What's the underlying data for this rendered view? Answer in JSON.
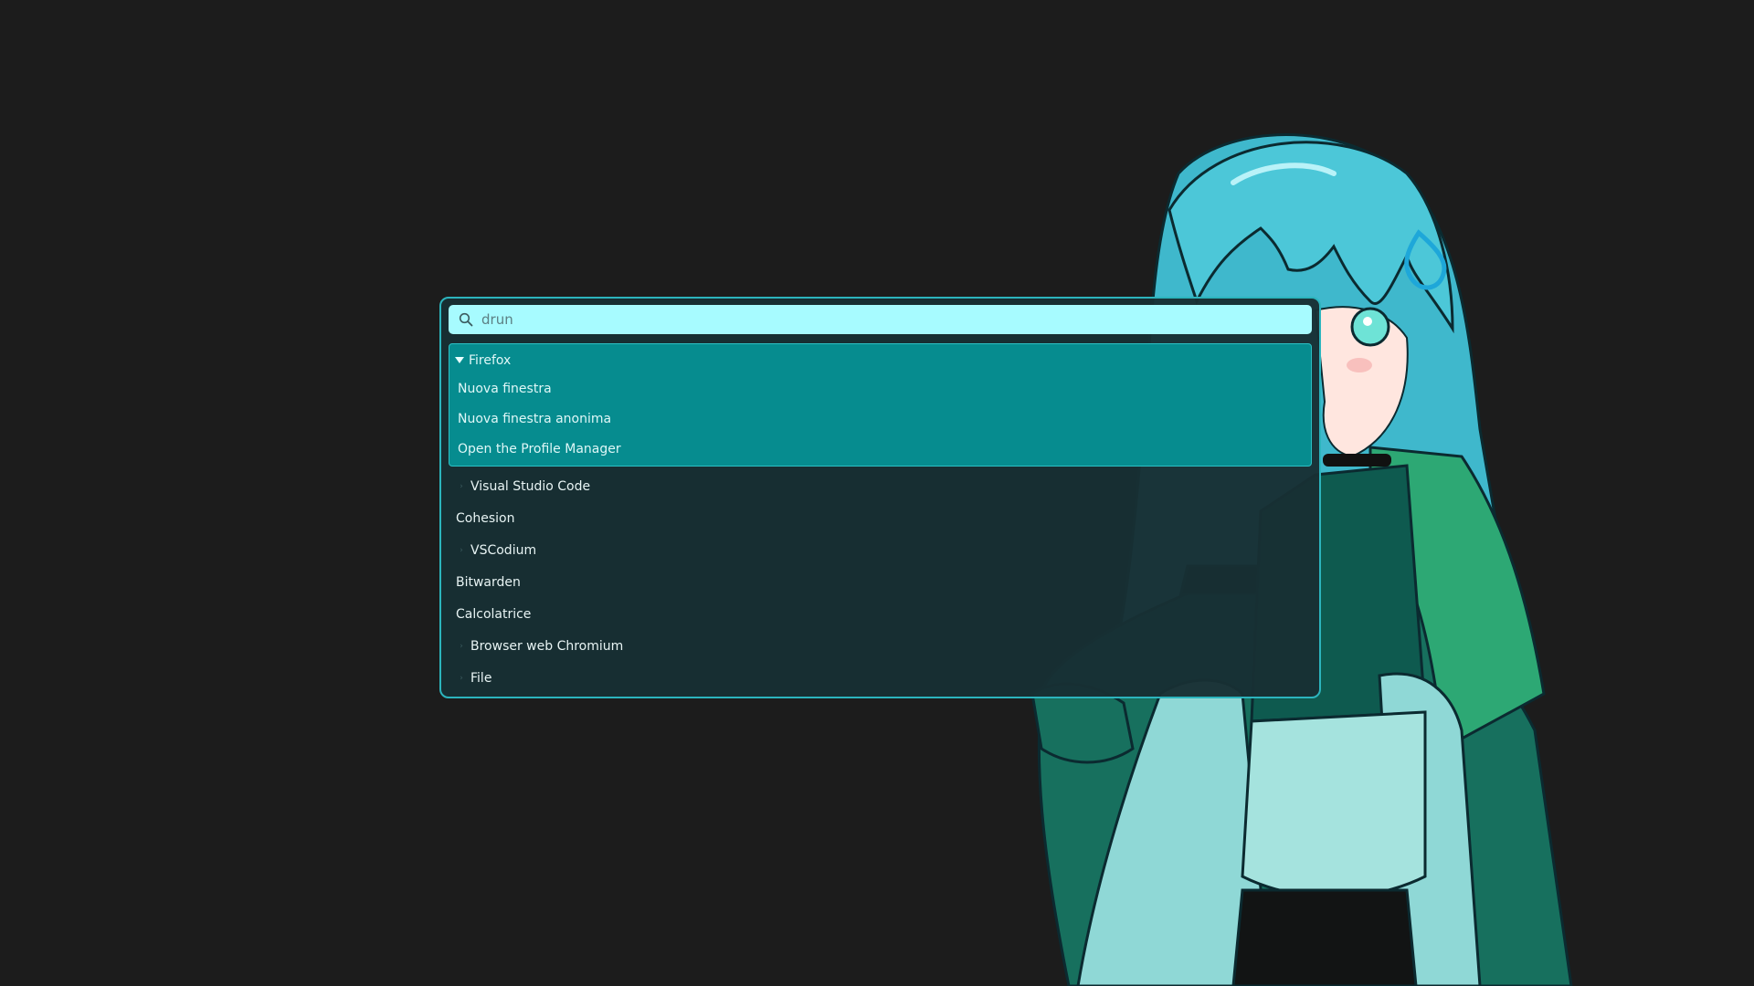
{
  "search": {
    "placeholder": "drun",
    "value": "",
    "icon": "search-icon"
  },
  "selected_group": {
    "title": "Firefox",
    "expanded": true,
    "actions": [
      {
        "label": "Nuova finestra"
      },
      {
        "label": "Nuova finestra anonima"
      },
      {
        "label": "Open the Profile Manager"
      }
    ]
  },
  "items": [
    {
      "label": "Visual Studio Code",
      "has_children": true
    },
    {
      "label": "Cohesion",
      "has_children": false
    },
    {
      "label": "VSCodium",
      "has_children": true
    },
    {
      "label": "Bitwarden",
      "has_children": false
    },
    {
      "label": "Calcolatrice",
      "has_children": false
    },
    {
      "label": "Browser web Chromium",
      "has_children": true
    },
    {
      "label": "File",
      "has_children": true
    }
  ],
  "colors": {
    "background": "#1c1c1c",
    "launcher_bg": "#182f34",
    "launcher_border": "#2cb4bd",
    "search_bg": "#a7fbff",
    "selected_bg": "#068c8f"
  }
}
